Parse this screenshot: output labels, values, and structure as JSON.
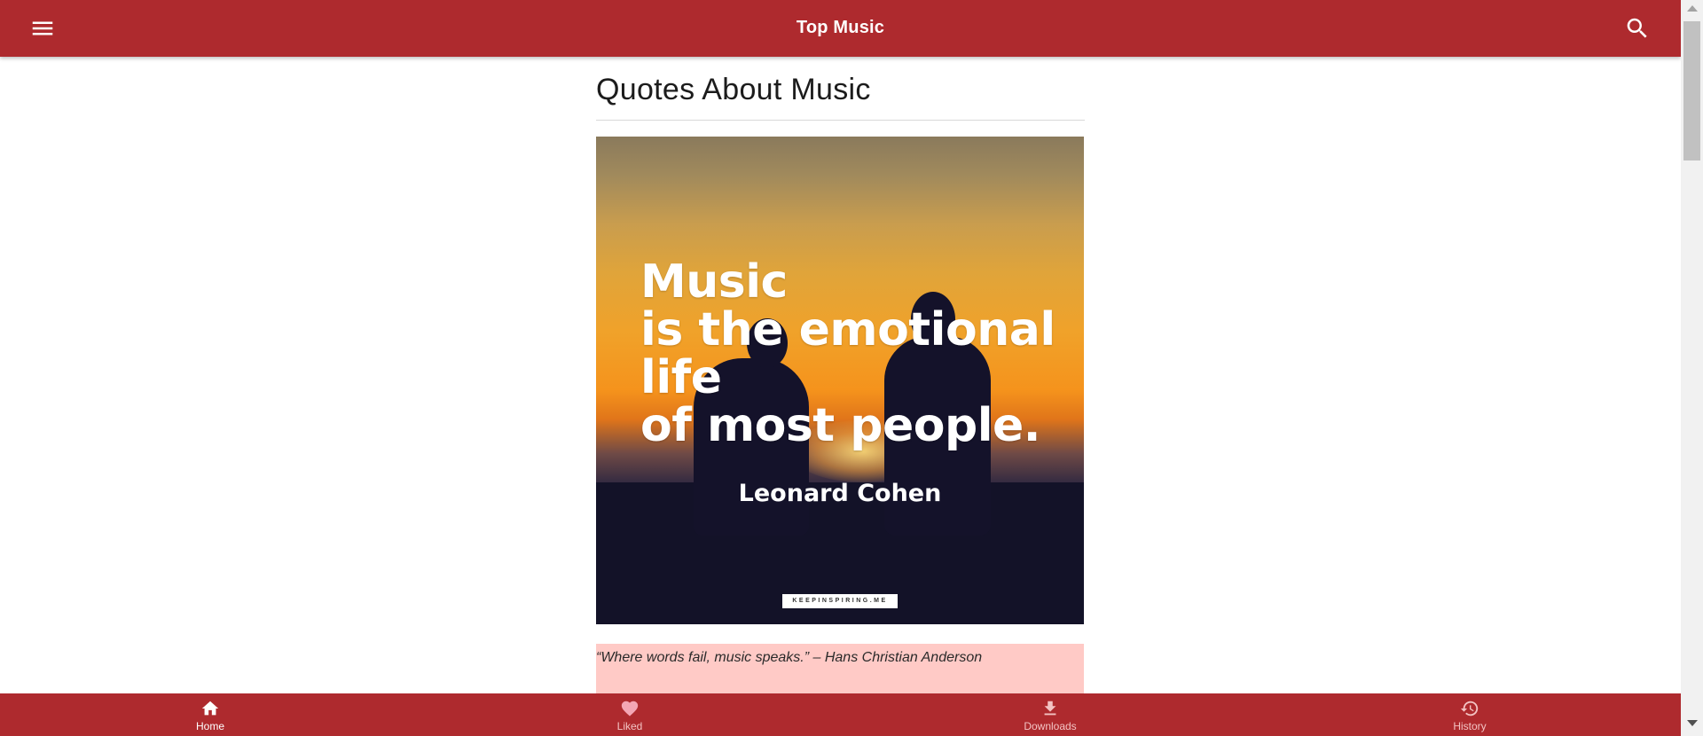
{
  "app_bar": {
    "title": "Top Music",
    "menu_icon": "menu-icon",
    "search_icon": "search-icon",
    "background": "#ae2a2e"
  },
  "page": {
    "title": "Quotes About Music"
  },
  "quote_image": {
    "lines": [
      "Music",
      "is the emotional",
      "life",
      "of most people."
    ],
    "author": "Leonard Cohen",
    "watermark": "KEEPINSPIRING.ME"
  },
  "quote_card": {
    "text": "“Where words fail, music speaks.” – Hans Christian Anderson",
    "background": "#ffcac6"
  },
  "bottom_nav": {
    "items": [
      {
        "label": "Home",
        "icon": "home-icon",
        "active": true
      },
      {
        "label": "Liked",
        "icon": "heart-icon",
        "active": false
      },
      {
        "label": "Downloads",
        "icon": "download-icon",
        "active": false
      },
      {
        "label": "History",
        "icon": "history-icon",
        "active": false
      }
    ]
  }
}
